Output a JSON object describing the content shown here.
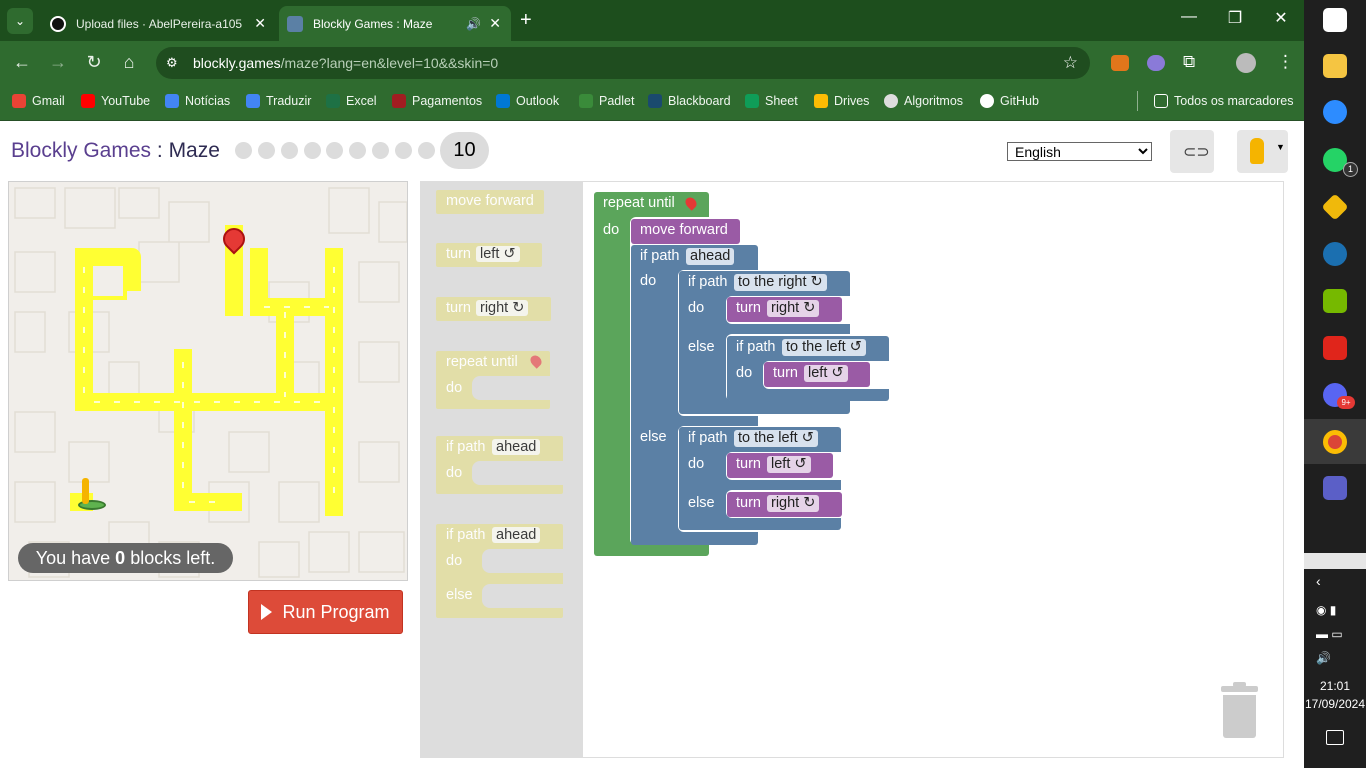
{
  "browser": {
    "tabs": [
      {
        "title": "Upload files · AbelPereira-a105",
        "active": false
      },
      {
        "title": "Blockly Games : Maze",
        "active": true
      }
    ],
    "url_host": "blockly.games",
    "url_path": "/maze?lang=en&level=10&&skin=0",
    "bookmarks": [
      "Gmail",
      "YouTube",
      "Notícias",
      "Traduzir",
      "Excel",
      "Pagamentos",
      "Outlook",
      "Padlet",
      "Blackboard",
      "Sheet",
      "Drives",
      "Algoritmos",
      "GitHub"
    ],
    "all_bookmarks": "Todos os marcadores"
  },
  "page": {
    "app_title": "Blockly Games",
    "separator": " : ",
    "game_title": "Maze",
    "level": "10",
    "language": "English",
    "blocks_left_prefix": "You have ",
    "blocks_left_count": "0",
    "blocks_left_suffix": " blocks left.",
    "run_label": "Run Program"
  },
  "toolbox": {
    "move_forward": "move forward",
    "turn": "turn",
    "left": "left ↺",
    "right": "right ↻",
    "repeat_until": "repeat until",
    "do": "do",
    "if_path": "if path",
    "ahead": "ahead",
    "else": "else"
  },
  "program": {
    "repeat_until": "repeat until",
    "do": "do",
    "move_forward": "move forward",
    "if_path": "if path",
    "ahead": "ahead",
    "to_the_right": "to the right ↻",
    "to_the_left": "to the left ↺",
    "turn": "turn",
    "right": "right ↻",
    "left": "left ↺",
    "else": "else"
  },
  "taskbar": {
    "time": "21:01",
    "date": "17/09/2024",
    "whatsapp_badge": "1",
    "discord_badge": "9+"
  },
  "colors": {
    "loop": "#5ba55b",
    "logic": "#5b80a5",
    "movement": "#9a5ba5",
    "run": "#dd4b39",
    "path": "#ffff33"
  }
}
